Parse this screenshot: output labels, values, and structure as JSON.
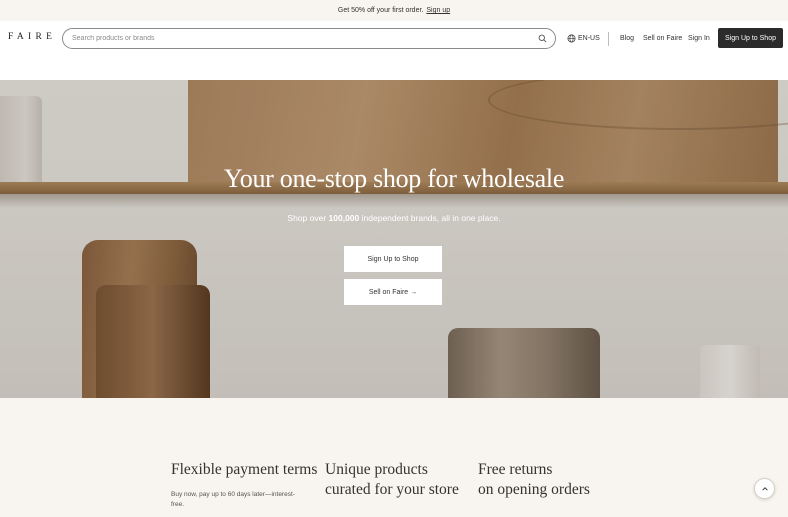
{
  "promo": {
    "text": "Get 50% off your first order.",
    "link": "Sign up"
  },
  "header": {
    "logo": "FAIRE",
    "search_placeholder": "Search products or brands",
    "search_icon": "search-icon",
    "language": "EN-US",
    "language_icon": "globe-icon",
    "links": {
      "blog": "Blog",
      "sell": "Sell on Faire",
      "signin": "Sign In"
    },
    "cta": "Sign Up to Shop"
  },
  "hero": {
    "title": "Your one-stop shop for wholesale",
    "sub_pre": "Shop over",
    "sub_bold": "100,000",
    "sub_post": "independent brands, all in one place.",
    "btn_primary": "Sign Up to Shop",
    "btn_secondary": "Sell on Faire →"
  },
  "features": [
    {
      "title_line1": "Flexible payment terms",
      "title_line2": "",
      "desc": "Buy now, pay up to 60 days later—interest-free."
    },
    {
      "title_line1": "Unique products",
      "title_line2": "curated for your store",
      "desc": ""
    },
    {
      "title_line1": "Free returns",
      "title_line2": "on opening orders",
      "desc": ""
    }
  ],
  "scroll_top_icon": "chevron-up-icon",
  "colors": {
    "dark_button": "#2b2b2b",
    "promo_bg": "#f8f4ef"
  }
}
